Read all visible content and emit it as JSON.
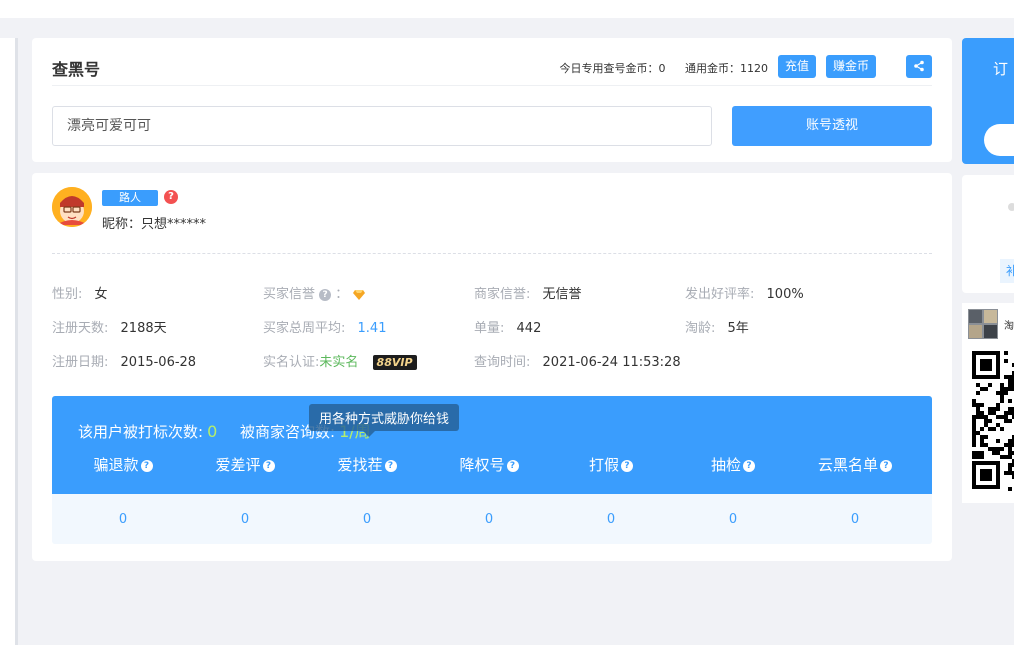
{
  "search": {
    "title": "查黑号",
    "daily_coins_label": "今日专用查号金币：",
    "daily_coins_value": "0",
    "general_coins_label": "通用金币：",
    "general_coins_value": "1120",
    "recharge_label": "充值",
    "earn_label": "赚金币",
    "share_icon": "share-icon",
    "input_value": "漂亮可爱可可",
    "submit_label": "账号透视"
  },
  "profile": {
    "tag": "路人",
    "nickname": "昵称：只想******",
    "fields": {
      "gender_label": "性别:",
      "gender_value": "女",
      "buyer_credit_label": "买家信誉",
      "buyer_credit_sep": "：",
      "buyer_credit_icon": "diamond-icon",
      "merchant_credit_label": "商家信誉:",
      "merchant_credit_value": "无信誉",
      "good_rate_label": "发出好评率:",
      "good_rate_value": "100%",
      "reg_days_label": "注册天数:",
      "reg_days_value": "2188天",
      "weekly_avg_label": "买家总周平均:",
      "weekly_avg_value": "1.41",
      "order_count_label": "单量:",
      "order_count_value": "442",
      "taobao_age_label": "淘龄:",
      "taobao_age_value": "5年",
      "reg_date_label": "注册日期:",
      "reg_date_value": "2015-06-28",
      "realname_label": "实名认证:",
      "realname_value": "未实名",
      "vip_badge": "88VIP",
      "query_time_label": "查询时间:",
      "query_time_value": "2021-06-24 11:53:28"
    }
  },
  "stats": {
    "marked_label": "该用户被打标次数:",
    "marked_value": "0",
    "consult_label": "被商家咨询数:",
    "consult_value": "1/周",
    "tooltip": "用各种方式威胁你给钱",
    "columns": [
      {
        "label": "骗退款",
        "value": "0"
      },
      {
        "label": "爱差评",
        "value": "0"
      },
      {
        "label": "爱找茬",
        "value": "0"
      },
      {
        "label": "降权号",
        "value": "0"
      },
      {
        "label": "打假",
        "value": "0"
      },
      {
        "label": "抽检",
        "value": "0"
      },
      {
        "label": "云黑名单",
        "value": "0"
      }
    ]
  },
  "side": {
    "order_label_partial": "订",
    "white_label_partial": "补",
    "qr_label_partial": "淘"
  },
  "colors": {
    "primary": "#3a9dfd",
    "highlight_green": "#b6ef6a",
    "danger": "#f35151"
  }
}
